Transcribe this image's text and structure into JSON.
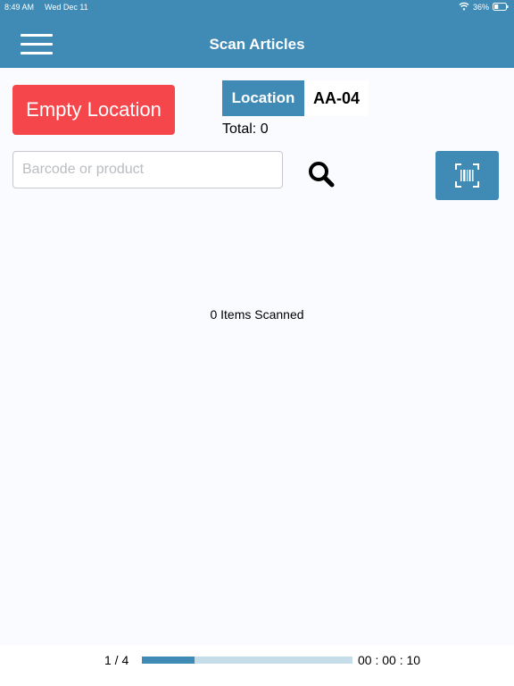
{
  "status_bar": {
    "time": "8:49 AM",
    "date": "Wed Dec 11",
    "battery_percent": "36%",
    "battery_level": 0.36
  },
  "header": {
    "title": "Scan Articles",
    "menu_icon": "hamburger-icon"
  },
  "actions": {
    "empty_location_label": "Empty Location"
  },
  "location": {
    "label": "Location",
    "value": "AA-04",
    "total_label": "Total: ",
    "total_value": "0"
  },
  "search": {
    "placeholder": "Barcode or product",
    "value": "",
    "search_icon": "search-icon",
    "scan_icon": "barcode-scan-icon"
  },
  "scanned": {
    "text": "0 Items Scanned"
  },
  "footer": {
    "page": "1 / 4",
    "progress": 0.25,
    "timer": "00 : 00 : 10"
  },
  "colors": {
    "primary": "#3f8bb6",
    "danger": "#f5464b",
    "progress_track": "#c5dde8",
    "background": "#f9fbfe"
  }
}
